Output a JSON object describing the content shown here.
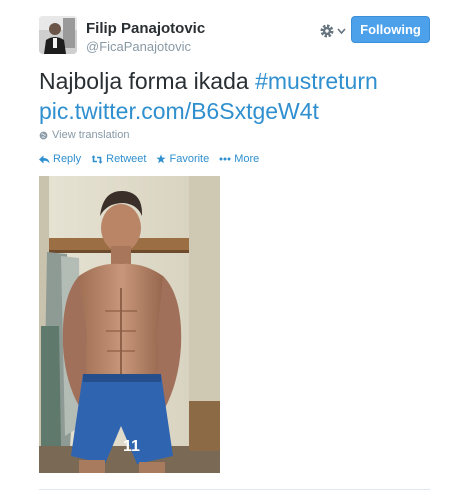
{
  "user": {
    "name": "Filip Panajotovic",
    "handle": "@FicaPanajotovic"
  },
  "follow_button": {
    "label": "Following",
    "color": "#4ca1ea"
  },
  "tweet": {
    "text_plain": "Najbolja forma ikada",
    "hashtag": "#mustreturn",
    "pic_link": "pic.twitter.com/B6SxtgeW4t",
    "link_color": "#2f8fcf"
  },
  "translation": {
    "label": "View translation",
    "icon": "globe-icon"
  },
  "actions": {
    "reply": {
      "label": "Reply",
      "icon": "reply-icon"
    },
    "retweet": {
      "label": "Retweet",
      "icon": "retweet-icon"
    },
    "favorite": {
      "label": "Favorite",
      "icon": "star-icon"
    },
    "more": {
      "label": "More",
      "icon": "more-dots-icon"
    }
  },
  "menu": {
    "icon": "gear-icon"
  }
}
